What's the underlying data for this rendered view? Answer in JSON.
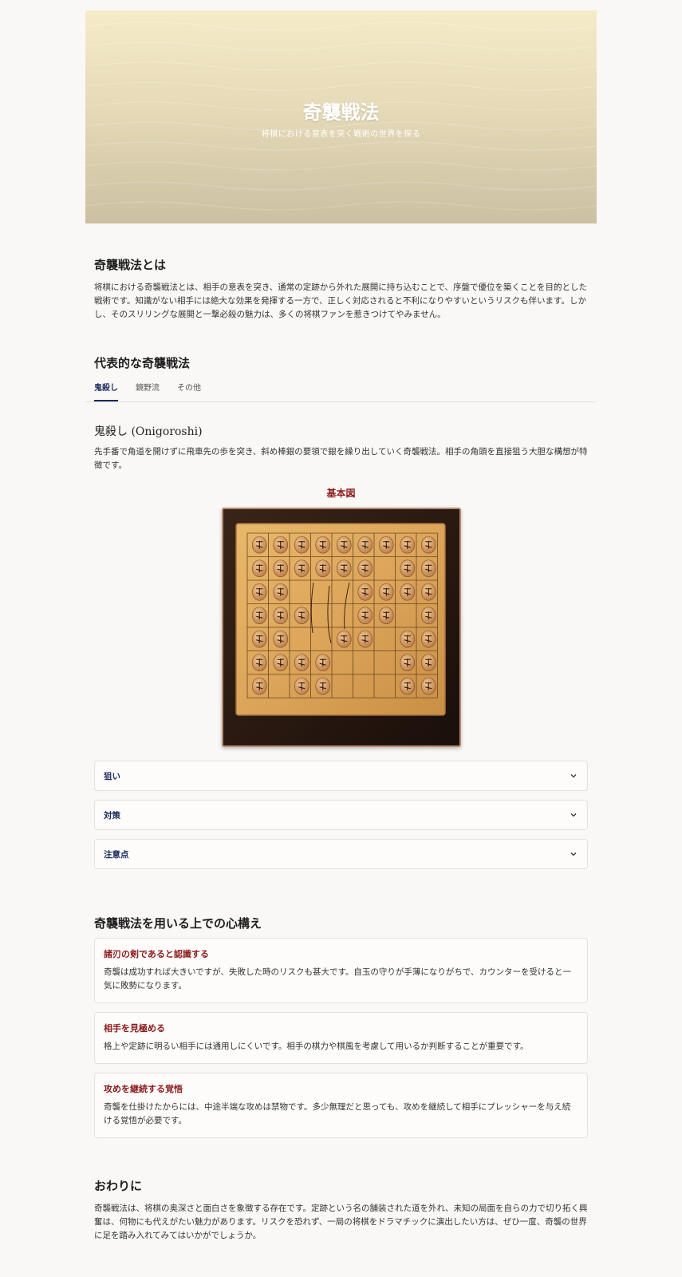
{
  "hero": {
    "title": "奇襲戦法",
    "subtitle": "将棋における意表を突く戦術の世界を探る"
  },
  "intro": {
    "heading": "奇襲戦法とは",
    "body": "将棋における奇襲戦法とは、相手の意表を突き、通常の定跡から外れた展開に持ち込むことで、序盤で優位を築くことを目的とした戦術です。知識がない相手には絶大な効果を発揮する一方で、正しく対応されると不利になりやすいというリスクも伴います。しかし、そのスリリングな展開と一撃必殺の魅力は、多くの将棋ファンを惹きつけてやみません。"
  },
  "tactics": {
    "heading": "代表的な奇襲戦法",
    "tabs": [
      "鬼殺し",
      "鏡野流",
      "その他"
    ],
    "active_tab": "鬼殺し",
    "detail_title": "鬼殺し (Onigoroshi)",
    "detail_body": "先手番で角道を開けずに飛車先の歩を突き、斜め棒銀の要領で銀を繰り出していく奇襲戦法。相手の角頭を直接狙う大胆な構想が特徴です。",
    "figure_title": "基本図",
    "accordions": [
      "狙い",
      "対策",
      "注意点"
    ]
  },
  "mindset": {
    "heading": "奇襲戦法を用いる上での心構え",
    "cards": [
      {
        "title": "諸刃の剣であると認識する",
        "body": "奇襲は成功すれば大きいですが、失敗した時のリスクも甚大です。自玉の守りが手薄になりがちで、カウンターを受けると一気に敗勢になります。"
      },
      {
        "title": "相手を見極める",
        "body": "格上や定跡に明るい相手には通用しにくいです。相手の棋力や棋風を考慮して用いるか判断することが重要です。"
      },
      {
        "title": "攻めを継続する覚悟",
        "body": "奇襲を仕掛けたからには、中途半端な攻めは禁物です。多少無理だと思っても、攻めを継続して相手にプレッシャーを与え続ける覚悟が必要です。"
      }
    ]
  },
  "closing": {
    "heading": "おわりに",
    "body": "奇襲戦法は、将棋の奥深さと面白さを象徴する存在です。定跡という名の舗装された道を外れ、未知の局面を自らの力で切り拓く興奮は、何物にも代えがたい魅力があります。リスクを恐れず、一局の将棋をドラマチックに演出したい方は、ぜひ一度、奇襲の世界に足を踏み入れてみてはいかがでしょうか。"
  },
  "icons": {
    "accordion_toggle": "chevron-down-icon"
  },
  "colors": {
    "accent_navy": "#1b2a5c",
    "accent_red": "#8b1a1a",
    "background": "#f9f8f6"
  }
}
